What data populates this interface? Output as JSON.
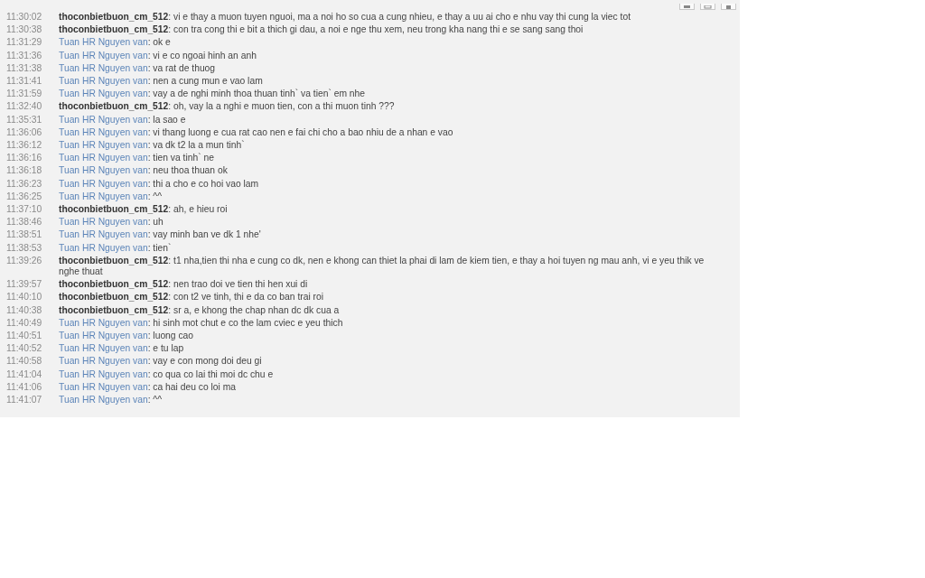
{
  "messages": [
    {
      "time": "11:30:02",
      "sender": "thoconbietbuon_cm_512",
      "kind": "local",
      "text": ": vi e thay a muon tuyen nguoi, ma a noi ho so cua a cung nhieu, e thay a uu ai cho e nhu vay thi cung la viec tot"
    },
    {
      "time": "11:30:38",
      "sender": "thoconbietbuon_cm_512",
      "kind": "local",
      "text": ": con tra cong thi e bit a thich gi dau, a noi e nge thu xem, neu trong kha nang thi e se sang sang thoi"
    },
    {
      "time": "11:31:29",
      "sender": "Tuan HR Nguyen van",
      "kind": "remote",
      "text": ": ok e"
    },
    {
      "time": "11:31:36",
      "sender": "Tuan HR Nguyen van",
      "kind": "remote",
      "text": ": vi e co ngoai hinh an anh"
    },
    {
      "time": "11:31:38",
      "sender": "Tuan HR Nguyen van",
      "kind": "remote",
      "text": ": va rat de thuog"
    },
    {
      "time": "11:31:41",
      "sender": "Tuan HR Nguyen van",
      "kind": "remote",
      "text": ": nen a cung mun e vao lam"
    },
    {
      "time": "11:31:59",
      "sender": "Tuan HR Nguyen van",
      "kind": "remote",
      "text": ": vay a de nghi minh thoa thuan tinh` va tien` em nhe"
    },
    {
      "time": "11:32:40",
      "sender": "thoconbietbuon_cm_512",
      "kind": "local",
      "text": ": oh, vay la a nghi e muon tien, con a thi muon tinh ???"
    },
    {
      "time": "11:35:31",
      "sender": "Tuan HR Nguyen van",
      "kind": "remote",
      "text": ": la sao e"
    },
    {
      "time": "11:36:06",
      "sender": "Tuan HR Nguyen van",
      "kind": "remote",
      "text": ": vi thang luong e cua rat cao nen e fai chi cho a bao nhiu de a nhan e vao"
    },
    {
      "time": "11:36:12",
      "sender": "Tuan HR Nguyen van",
      "kind": "remote",
      "text": ": va dk t2 la a mun tinh`"
    },
    {
      "time": "11:36:16",
      "sender": "Tuan HR Nguyen van",
      "kind": "remote",
      "text": ": tien va tinh` ne"
    },
    {
      "time": "11:36:18",
      "sender": "Tuan HR Nguyen van",
      "kind": "remote",
      "text": ": neu thoa thuan ok"
    },
    {
      "time": "11:36:23",
      "sender": "Tuan HR Nguyen van",
      "kind": "remote",
      "text": ": thi a cho e co hoi vao lam"
    },
    {
      "time": "11:36:25",
      "sender": "Tuan HR Nguyen van",
      "kind": "remote",
      "text": ": ^^"
    },
    {
      "time": "11:37:10",
      "sender": "thoconbietbuon_cm_512",
      "kind": "local",
      "text": ": ah, e hieu roi"
    },
    {
      "time": "11:38:46",
      "sender": "Tuan HR Nguyen van",
      "kind": "remote",
      "text": ": uh"
    },
    {
      "time": "11:38:51",
      "sender": "Tuan HR Nguyen van",
      "kind": "remote",
      "text": ": vay minh ban ve dk 1 nhe'"
    },
    {
      "time": "11:38:53",
      "sender": "Tuan HR Nguyen van",
      "kind": "remote",
      "text": ": tien`"
    },
    {
      "time": "11:39:26",
      "sender": "thoconbietbuon_cm_512",
      "kind": "local",
      "text": ": t1 nha,tien thi nha e cung co dk, nen e khong can thiet la phai di lam de kiem tien, e thay a hoi tuyen ng mau anh, vi e yeu thik ve nghe thuat"
    },
    {
      "time": "11:39:57",
      "sender": "thoconbietbuon_cm_512",
      "kind": "local",
      "text": ": nen trao doi ve tien thi hen xui di"
    },
    {
      "time": "11:40:10",
      "sender": "thoconbietbuon_cm_512",
      "kind": "local",
      "text": ": con t2 ve tinh, thi e da co ban trai roi"
    },
    {
      "time": "11:40:38",
      "sender": "thoconbietbuon_cm_512",
      "kind": "local",
      "text": ": sr a, e khong the chap nhan dc dk cua a"
    },
    {
      "time": "11:40:49",
      "sender": "Tuan HR Nguyen van",
      "kind": "remote",
      "text": ": hi sinh mot chut e co the lam cviec e yeu thich"
    },
    {
      "time": "11:40:51",
      "sender": "Tuan HR Nguyen van",
      "kind": "remote",
      "text": ": luong cao"
    },
    {
      "time": "11:40:52",
      "sender": "Tuan HR Nguyen van",
      "kind": "remote",
      "text": ": e tu lap"
    },
    {
      "time": "11:40:58",
      "sender": "Tuan HR Nguyen van",
      "kind": "remote",
      "text": ": vay e con mong doi deu gi"
    },
    {
      "time": "11:41:04",
      "sender": "Tuan HR Nguyen van",
      "kind": "remote",
      "text": ": co qua co lai thi moi dc chu e"
    },
    {
      "time": "11:41:06",
      "sender": "Tuan HR Nguyen van",
      "kind": "remote",
      "text": ": ca hai deu co loi ma"
    },
    {
      "time": "11:41:07",
      "sender": "Tuan HR Nguyen van",
      "kind": "remote",
      "text": ": ^^"
    }
  ]
}
